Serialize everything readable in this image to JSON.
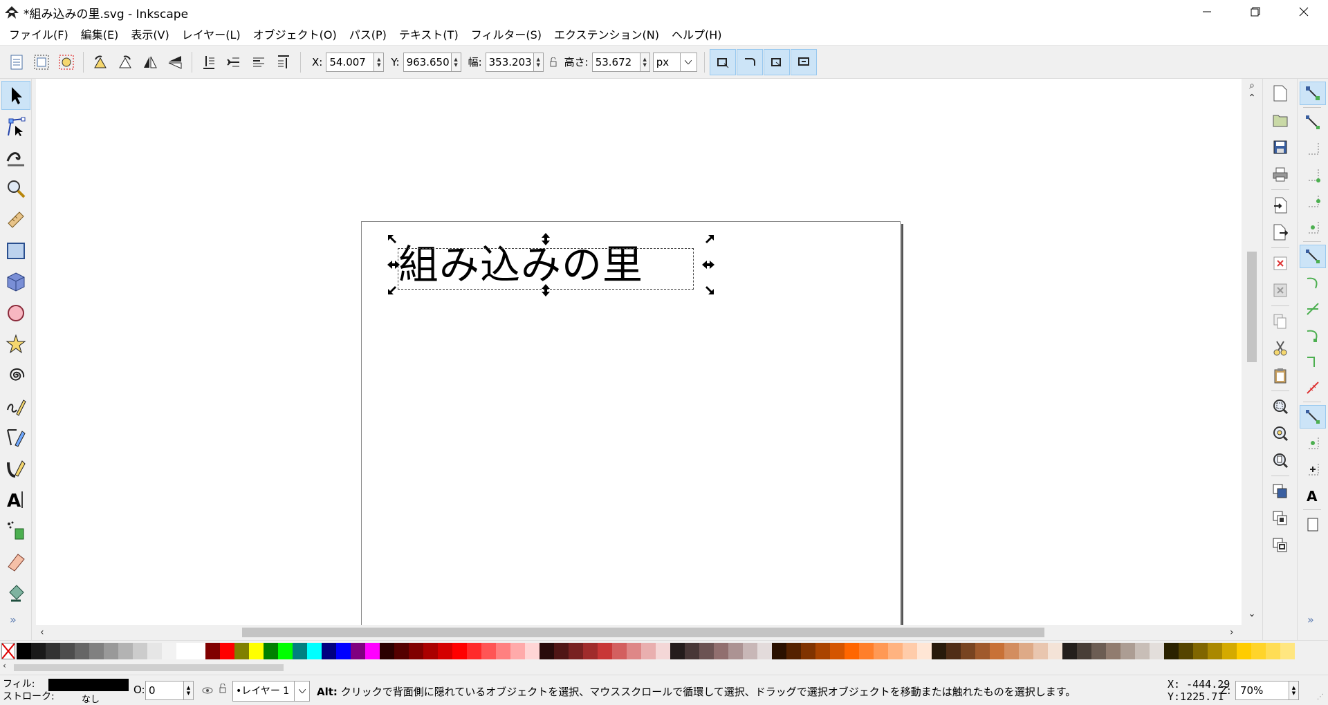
{
  "window": {
    "title": "*組み込みの里.svg - Inkscape"
  },
  "menu": [
    "ファイル(F)",
    "編集(E)",
    "表示(V)",
    "レイヤー(L)",
    "オブジェクト(O)",
    "パス(P)",
    "テキスト(T)",
    "フィルター(S)",
    "エクステンション(N)",
    "ヘルプ(H)"
  ],
  "toolbar": {
    "x_label": "X:",
    "x_value": "54.007",
    "y_label": "Y:",
    "y_value": "963.650",
    "w_label": "幅:",
    "w_value": "353.203",
    "h_label": "高さ:",
    "h_value": "53.672",
    "unit": "px"
  },
  "canvas": {
    "text": "組み込みの里"
  },
  "status": {
    "fill_label": "フィル:",
    "stroke_label": "ストローク:",
    "stroke_value": "なし",
    "fill_color": "#000000",
    "opacity_label": "O:",
    "opacity_value": "0",
    "layer": "•レイヤー 1",
    "message_key": "Alt:",
    "message": " クリックで背面側に隠れているオブジェクトを選択、マウススクロールで循環して選択、ドラッグで選択オブジェクトを移動または触れたものを選択します。",
    "cursor_x": "X: -444.29",
    "cursor_y": "Y:1225.71",
    "zoom_label": "Z:",
    "zoom": "70%"
  },
  "palette": [
    "#000000",
    "#1a1a1a",
    "#333333",
    "#4d4d4d",
    "#666666",
    "#808080",
    "#999999",
    "#b3b3b3",
    "#cccccc",
    "#e6e6e6",
    "#f2f2f2",
    "#ffffff",
    "#ffffff",
    "#800000",
    "#ff0000",
    "#808000",
    "#ffff00",
    "#008000",
    "#00ff00",
    "#008080",
    "#00ffff",
    "#000080",
    "#0000ff",
    "#800080",
    "#ff00ff",
    "#2b0000",
    "#550000",
    "#800000",
    "#aa0000",
    "#d40000",
    "#ff0000",
    "#ff2a2a",
    "#ff5555",
    "#ff8080",
    "#ffaaaa",
    "#ffd5d5",
    "#280b0b",
    "#501616",
    "#782121",
    "#a02c2c",
    "#c83737",
    "#d35f5f",
    "#de8787",
    "#e9afaf",
    "#f4d7d7",
    "#241c1c",
    "#483737",
    "#6c5353",
    "#916f6f",
    "#ac9393",
    "#c8b7b7",
    "#e3dbdb",
    "#2b1100",
    "#552200",
    "#803300",
    "#aa4400",
    "#d45500",
    "#ff6600",
    "#ff7f2a",
    "#ff9955",
    "#ffb380",
    "#ffccaa",
    "#ffe6d5",
    "#281a0b",
    "#502d16",
    "#784421",
    "#a05a2c",
    "#c87137",
    "#d38d5f",
    "#deaa87",
    "#e9c6af",
    "#f4e3d7",
    "#241f1c",
    "#483e37",
    "#6c5d53",
    "#917c6f",
    "#ac9d93",
    "#c8beb7",
    "#e3dedb",
    "#2b2200",
    "#554400",
    "#806600",
    "#aa8800",
    "#d4aa00",
    "#ffcc00",
    "#ffd42a",
    "#ffdd55",
    "#ffe680"
  ]
}
